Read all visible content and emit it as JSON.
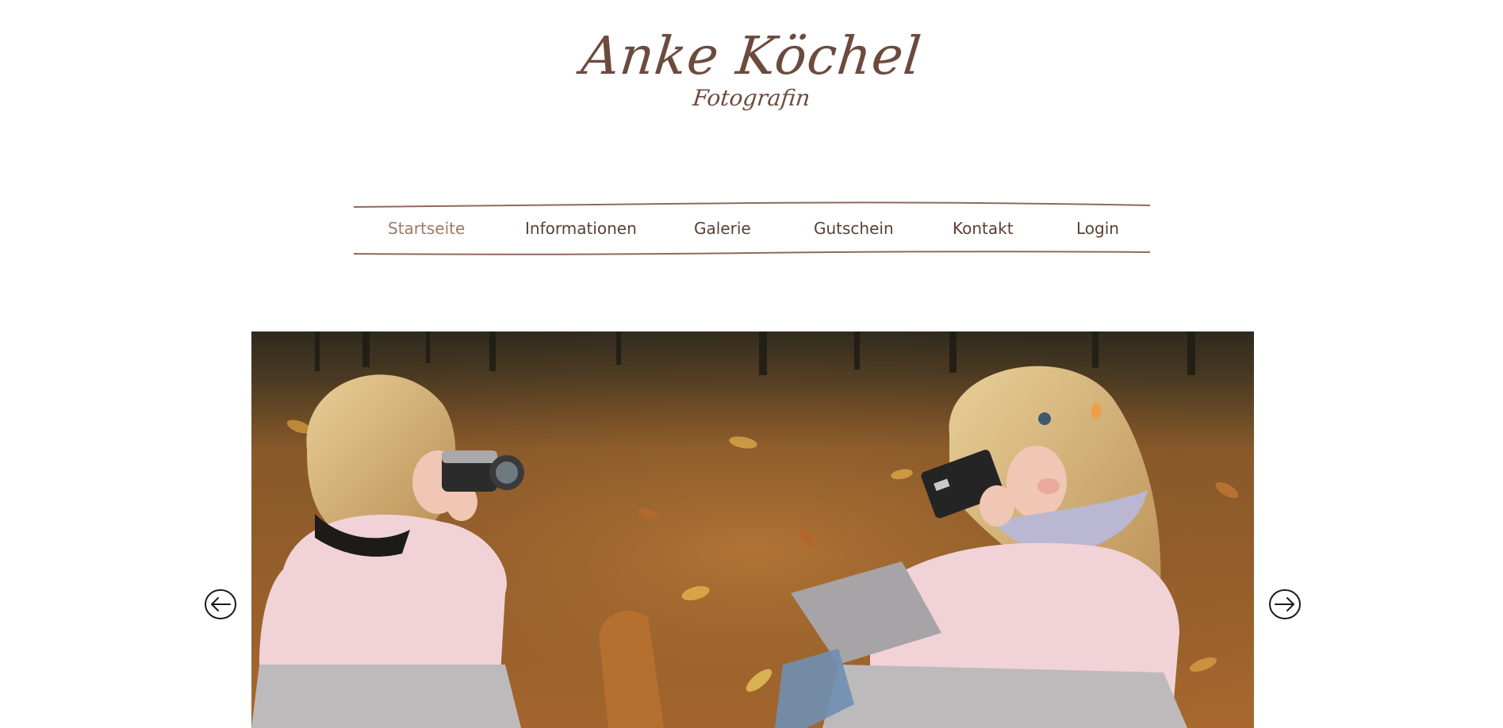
{
  "site": {
    "name": "Anke Köchel",
    "tagline": "Fotografin"
  },
  "nav": {
    "items": [
      {
        "label": "Startseite",
        "active": true
      },
      {
        "label": "Informationen",
        "active": false
      },
      {
        "label": "Galerie",
        "active": false
      },
      {
        "label": "Gutschein",
        "active": false
      },
      {
        "label": "Kontakt",
        "active": false
      },
      {
        "label": "Login",
        "active": false
      }
    ]
  },
  "slider": {
    "prev_icon": "arrow-left-circle-icon",
    "next_icon": "arrow-right-circle-icon",
    "image_subject": "two girls photographing each other with cameras in autumn leaves"
  },
  "colors": {
    "brand": "#6b4b3e",
    "nav_text": "#5a4034",
    "nav_active": "#9c7a6b"
  }
}
